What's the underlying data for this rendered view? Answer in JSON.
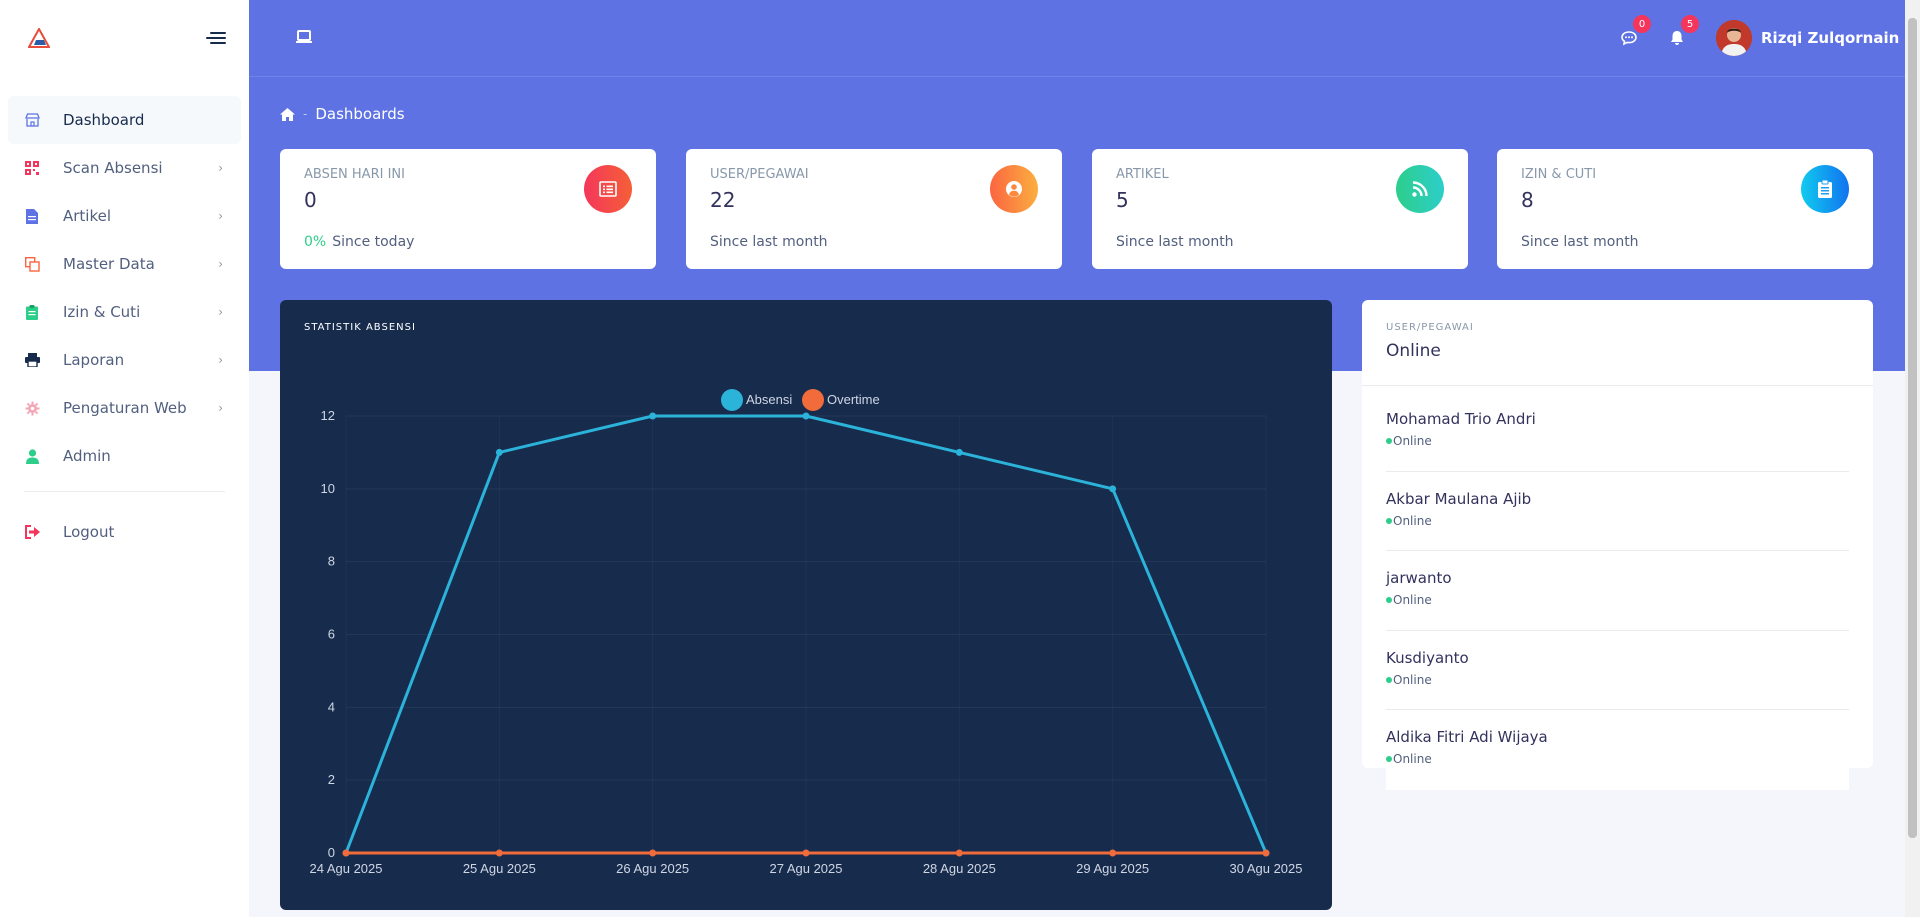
{
  "sidebar": {
    "logo_icon": "app-logo-icon",
    "menu_icon": "menu-toggle-icon",
    "items": [
      {
        "label": "Dashboard",
        "icon": "store-icon",
        "color": "#5e72e4",
        "active": true,
        "chevron": false
      },
      {
        "label": "Scan Absensi",
        "icon": "qrcode-icon",
        "color": "#f5365c",
        "active": false,
        "chevron": true
      },
      {
        "label": "Artikel",
        "icon": "file-icon",
        "color": "#5e72e4",
        "active": false,
        "chevron": true
      },
      {
        "label": "Master Data",
        "icon": "copy-icon",
        "color": "#fb6340",
        "active": false,
        "chevron": true
      },
      {
        "label": "Izin & Cuti",
        "icon": "clipboard-icon",
        "color": "#2dce89",
        "active": false,
        "chevron": true
      },
      {
        "label": "Laporan",
        "icon": "print-icon",
        "color": "#172b4d",
        "active": false,
        "chevron": true
      },
      {
        "label": "Pengaturan Web",
        "icon": "gear-icon",
        "color": "#f3a4b5",
        "active": false,
        "chevron": true
      },
      {
        "label": "Admin",
        "icon": "user-icon",
        "color": "#2dce89",
        "active": false,
        "chevron": false
      }
    ],
    "logout": {
      "label": "Logout",
      "icon": "sign-out-icon",
      "color": "#f5365c"
    }
  },
  "header": {
    "laptop_icon": "laptop-icon",
    "messages_badge": "0",
    "notifications_badge": "5",
    "user_name": "Rizqi Zulqornain"
  },
  "breadcrumb": {
    "home_icon": "home-icon",
    "separator": "-",
    "current": "Dashboards"
  },
  "stats": [
    {
      "title": "ABSEN HARI INI",
      "value": "0",
      "percent": "0%",
      "footer": "Since today",
      "icon": "list-icon",
      "gradient": [
        "#f5365c",
        "#f56036"
      ]
    },
    {
      "title": "USER/PEGAWAI",
      "value": "22",
      "percent": "",
      "footer": "Since last month",
      "icon": "user-circle-icon",
      "gradient": [
        "#fb6340",
        "#fbb140"
      ]
    },
    {
      "title": "ARTIKEL",
      "value": "5",
      "percent": "",
      "footer": "Since last month",
      "icon": "rss-icon",
      "gradient": [
        "#2dce89",
        "#2dcecc"
      ]
    },
    {
      "title": "IZIN & CUTI",
      "value": "8",
      "percent": "",
      "footer": "Since last month",
      "icon": "clipboard-check-icon",
      "gradient": [
        "#11cdef",
        "#1171ef"
      ]
    }
  ],
  "chart_title": "STATISTIK ABSENSI",
  "chart_data": {
    "type": "line",
    "title": "STATISTIK ABSENSI",
    "x": [
      "24 Agu 2025",
      "25 Agu 2025",
      "26 Agu 2025",
      "27 Agu 2025",
      "28 Agu 2025",
      "29 Agu 2025",
      "30 Agu 2025"
    ],
    "series": [
      {
        "name": "Absensi",
        "color": "#2bb3d9",
        "values": [
          0,
          11,
          12,
          12,
          11,
          10,
          0
        ]
      },
      {
        "name": "Overtime",
        "color": "#f26b3a",
        "values": [
          0,
          0,
          0,
          0,
          0,
          0,
          0
        ]
      }
    ],
    "yticks": [
      "0",
      "2",
      "4",
      "6",
      "8",
      "10",
      "12"
    ],
    "ylim": [
      0,
      12
    ],
    "grid": true,
    "legend": "top-center"
  },
  "online": {
    "subtitle": "USER/PEGAWAI",
    "title": "Online",
    "users": [
      {
        "name": "Mohamad Trio Andri",
        "status": "Online"
      },
      {
        "name": "Akbar Maulana Ajib",
        "status": "Online"
      },
      {
        "name": "jarwanto",
        "status": "Online"
      },
      {
        "name": "Kusdiyanto",
        "status": "Online"
      },
      {
        "name": "Aldika Fitri Adi Wijaya",
        "status": "Online"
      }
    ]
  }
}
